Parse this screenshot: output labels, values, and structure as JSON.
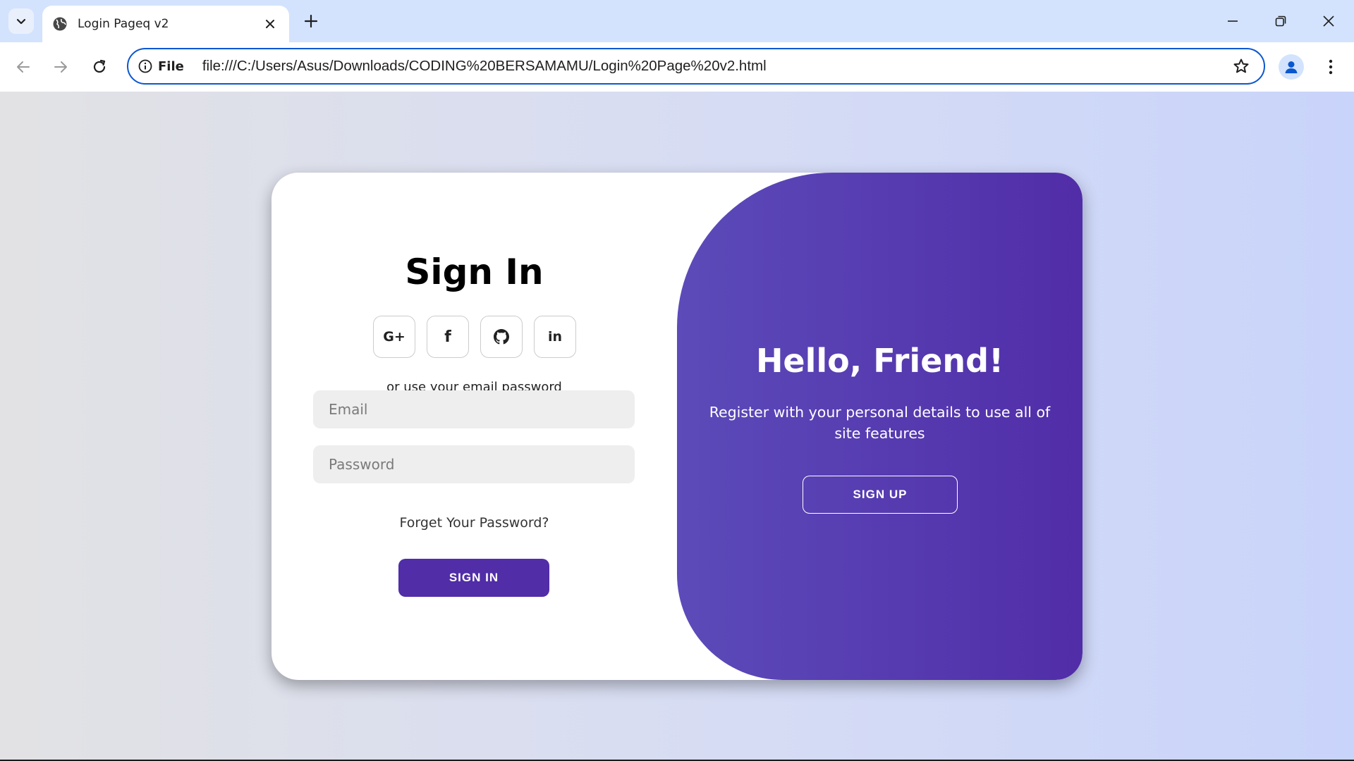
{
  "browser": {
    "tab": {
      "title": "Login Pageq v2"
    },
    "omnibox": {
      "site_label": "File",
      "url": "file:///C:/Users/Asus/Downloads/CODING%20BERSAMAMU/Login%20Page%20v2.html"
    },
    "icons": {
      "tab_list": "chevron-down-icon",
      "favicon": "globe-icon",
      "tab_close": "close-icon",
      "new_tab": "plus-icon",
      "minimize": "minimize-icon",
      "restore": "restore-icon",
      "close_window": "close-icon",
      "back": "arrow-left-icon",
      "forward": "arrow-right-icon",
      "reload": "reload-icon",
      "site_info": "info-icon",
      "bookmark": "star-icon",
      "profile": "person-icon",
      "menu": "more-vert-icon"
    },
    "accent_color": "#0b57d0"
  },
  "signin": {
    "title": "Sign In",
    "social": [
      {
        "label": "G+",
        "icon": "google-plus-icon"
      },
      {
        "label": "f",
        "icon": "facebook-icon"
      },
      {
        "label": "",
        "icon": "github-icon"
      },
      {
        "label": "in",
        "icon": "linkedin-icon"
      }
    ],
    "divider_text": "or use your email password",
    "email_placeholder": "Email",
    "password_placeholder": "Password",
    "forgot_password": "Forget Your Password?",
    "button_label": "SIGN IN",
    "button_color": "#512da8"
  },
  "welcome": {
    "title": "Hello, Friend!",
    "text": "Register with your personal details to use all of site features",
    "button_label": "SIGN UP",
    "gradient_start": "#5c4bb9",
    "gradient_end": "#512da8"
  }
}
